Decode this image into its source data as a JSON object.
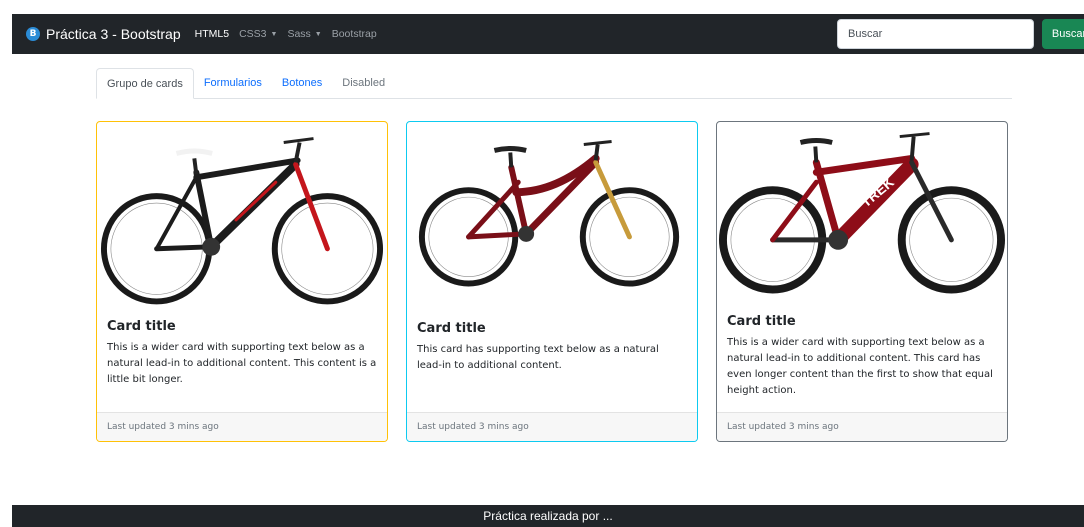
{
  "navbar": {
    "brand": "Práctica 3 - Bootstrap",
    "logo_letter": "B",
    "links": [
      {
        "label": "HTML5",
        "active": true
      },
      {
        "label": "CSS3",
        "dropdown": true
      },
      {
        "label": "Sass",
        "dropdown": true
      },
      {
        "label": "Bootstrap"
      }
    ],
    "search": {
      "placeholder": "Buscar",
      "button_label": "Buscar"
    }
  },
  "tabs": [
    {
      "label": "Grupo de cards",
      "active": true
    },
    {
      "label": "Formularios"
    },
    {
      "label": "Botones"
    },
    {
      "label": "Disabled",
      "disabled": true
    }
  ],
  "cards": [
    {
      "title": "Card title",
      "text": "This is a wider card with supporting text below as a natural lead-in to additional content. This content is a little bit longer.",
      "footer": "Last updated 3 mins ago",
      "border_color": "#ffc107",
      "bike_color": "#1c1c1c",
      "accent_color": "#c4161c"
    },
    {
      "title": "Card title",
      "text": "This card has supporting text below as a natural lead-in to additional content.",
      "footer": "Last updated 3 mins ago",
      "border_color": "#0dcaf0",
      "bike_color": "#7a0f18",
      "accent_color": "#c79b3b"
    },
    {
      "title": "Card title",
      "text": "This is a wider card with supporting text below as a natural lead-in to additional content. This card has even longer content than the first to show that equal height action.",
      "footer": "Last updated 3 mins ago",
      "border_color": "#6c757d",
      "bike_color": "#8e0d18",
      "accent_color": "#2a2a2a"
    }
  ],
  "footer": {
    "text": "Práctica realizada por ..."
  }
}
